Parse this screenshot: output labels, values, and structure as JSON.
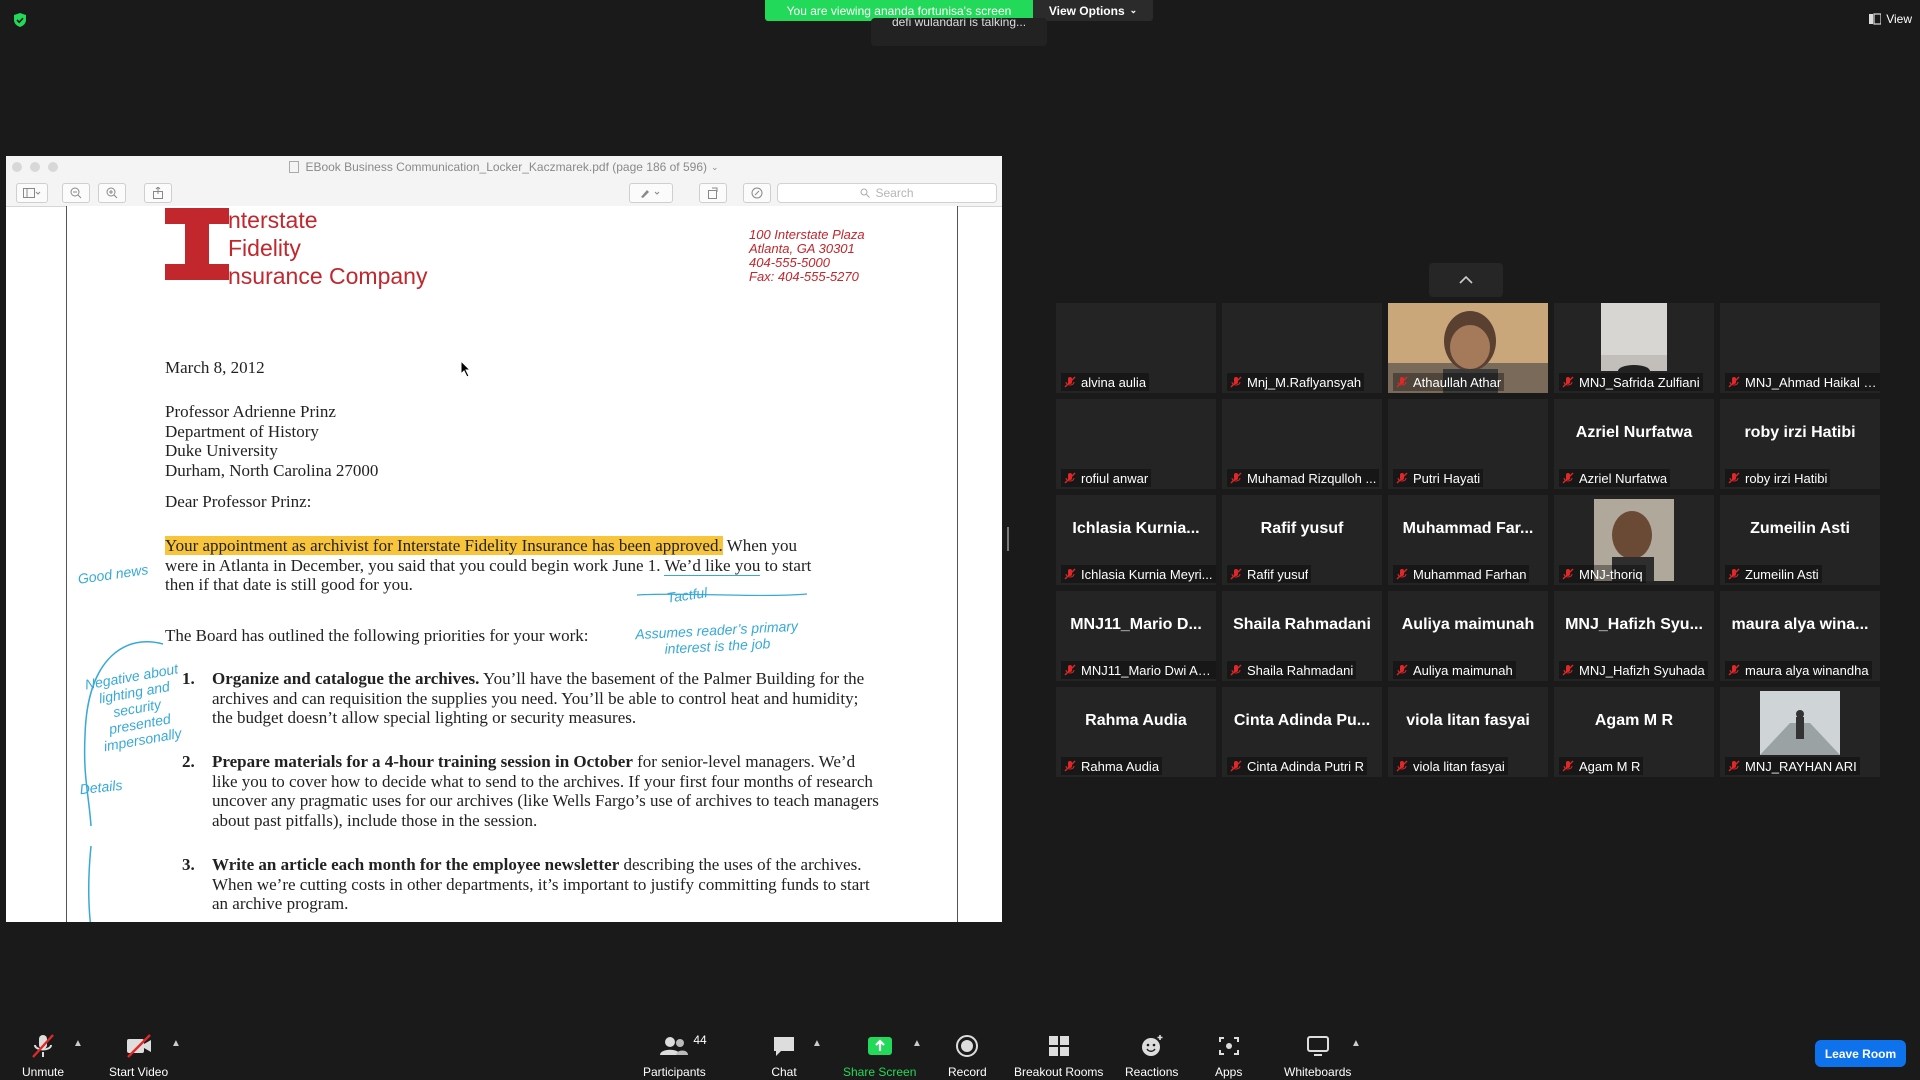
{
  "top": {
    "sharing_banner": "You are viewing ananda fortunisa's screen",
    "view_options": "View Options",
    "talking": "defi wulandari is talking...",
    "view": "View"
  },
  "window": {
    "title": "EBook Business Communication_Locker_Kaczmarek.pdf (page 186 of 596)",
    "search_placeholder": "Search"
  },
  "document": {
    "logo_line1": "nterstate",
    "logo_line2": "Fidelity",
    "logo_line3": "nsurance Company",
    "address": [
      "100 Interstate Plaza",
      "Atlanta, GA 30301",
      "404-555-5000",
      "Fax:  404-555-5270"
    ],
    "date": "March 8, 2012",
    "recipient": [
      "Professor Adrienne Prinz",
      "Department of History",
      "Duke University",
      "Durham, North Carolina  27000"
    ],
    "salutation": "Dear Professor Prinz:",
    "highlight": "Your appointment as archivist for Interstate Fidelity Insurance has been approved.",
    "para1_rest": "  When you",
    "para1_line2_a": "were in Atlanta in December, you said that you could begin work June 1. ",
    "para1_line2_b": "We’d like you",
    "para1_line2_c": " to start",
    "para1_line3": "then if that date is still good for you.",
    "board": "The Board has outlined the following priorities for your work:",
    "items": [
      {
        "num": "1.",
        "bold": "Organize and catalogue the archives.",
        "text": " You’ll have the basement of the Palmer Building for the archives and can requisition the supplies you need.  You’ll be able to control heat and humidity; the budget doesn’t allow special lighting or security measures."
      },
      {
        "num": "2.",
        "bold": "Prepare materials for a 4-hour training session in October",
        "text": " for senior-level managers. We’d like you to cover how to decide what to send to the archives.  If your first four months of research uncover any pragmatic uses for our archives (like Wells Fargo’s use of archives to teach managers about past pitfalls), include those in the session."
      },
      {
        "num": "3.",
        "bold": "Write an article each month for the employee newsletter",
        "text": " describing the uses of the archives. When we’re cutting costs in other departments, it’s important to justify committing funds to start an archive program."
      }
    ],
    "notes": {
      "good_news": "Good news",
      "tactful": "Tactful",
      "assumes": "Assumes reader’s primary interest is the job",
      "negative": "Negative about lighting and security presented impersonally",
      "details": "Details"
    }
  },
  "participants": [
    {
      "name": "alvina aulia",
      "big": ""
    },
    {
      "name": "Mnj_M.Raflyansyah",
      "big": ""
    },
    {
      "name": "Athaullah Athar",
      "big": ""
    },
    {
      "name": "MNJ_Safrida Zulfiani",
      "big": ""
    },
    {
      "name": "MNJ_Ahmad Haikal Fi...",
      "big": ""
    },
    {
      "name": "rofiul anwar",
      "big": ""
    },
    {
      "name": "Muhamad Rizqulloh ...",
      "big": ""
    },
    {
      "name": "Putri Hayati",
      "big": ""
    },
    {
      "name": "Azriel Nurfatwa",
      "big": "Azriel Nurfatwa"
    },
    {
      "name": "roby irzi Hatibi",
      "big": "roby irzi Hatibi"
    },
    {
      "name": "Ichlasia Kurnia Meyri...",
      "big": "Ichlasia  Kurnia..."
    },
    {
      "name": "Rafif yusuf",
      "big": "Rafif yusuf"
    },
    {
      "name": "Muhammad Farhan",
      "big": "Muhammad  Far..."
    },
    {
      "name": "MNJ-thoriq",
      "big": ""
    },
    {
      "name": "Zumeilin Asti",
      "big": "Zumeilin Asti"
    },
    {
      "name": "MNJ11_Mario Dwi An...",
      "big": "MNJ11_Mario  D..."
    },
    {
      "name": "Shaila Rahmadani",
      "big": "Shaila Rahmadani"
    },
    {
      "name": "Auliya maimunah",
      "big": "Auliya maimunah"
    },
    {
      "name": "MNJ_Hafizh Syuhada",
      "big": "MNJ_Hafizh  Syu..."
    },
    {
      "name": "maura alya winandha",
      "big": "maura alya wina..."
    },
    {
      "name": "Rahma Audia",
      "big": "Rahma Audia"
    },
    {
      "name": "Cinta Adinda Putri R",
      "big": "Cinta  Adinda  Pu..."
    },
    {
      "name": "viola litan fasyai",
      "big": "viola litan fasyai"
    },
    {
      "name": "Agam M R",
      "big": "Agam M R"
    },
    {
      "name": "MNJ_RAYHAN ARI",
      "big": ""
    }
  ],
  "toolbar": {
    "unmute": "Unmute",
    "start_video": "Start Video",
    "participants": "Participants",
    "participants_count": "44",
    "chat": "Chat",
    "share_screen": "Share Screen",
    "record": "Record",
    "breakout": "Breakout Rooms",
    "reactions": "Reactions",
    "apps": "Apps",
    "whiteboards": "Whiteboards",
    "leave": "Leave Room"
  },
  "colors": {
    "share_green": "#23d959",
    "leave_blue": "#0e72ed",
    "logo_red": "#c1272d",
    "annotation_blue": "#37a9d8",
    "highlight": "#f7c43c"
  }
}
